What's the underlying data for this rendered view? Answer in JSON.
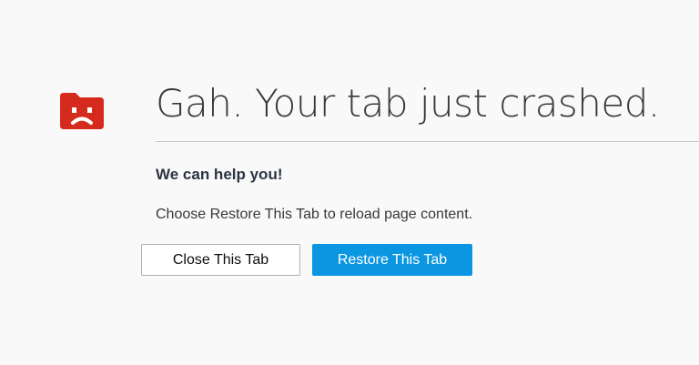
{
  "icon": "sad-tab-icon",
  "colors": {
    "icon_red": "#d52b1e",
    "accent": "#0a96e0",
    "background": "#f9f9fa"
  },
  "page": {
    "title": "Gah. Your tab just crashed.",
    "subtitle": "We can help you!",
    "message": "Choose Restore This Tab to reload page content."
  },
  "buttons": {
    "close_label": "Close This Tab",
    "restore_label": "Restore This Tab"
  }
}
